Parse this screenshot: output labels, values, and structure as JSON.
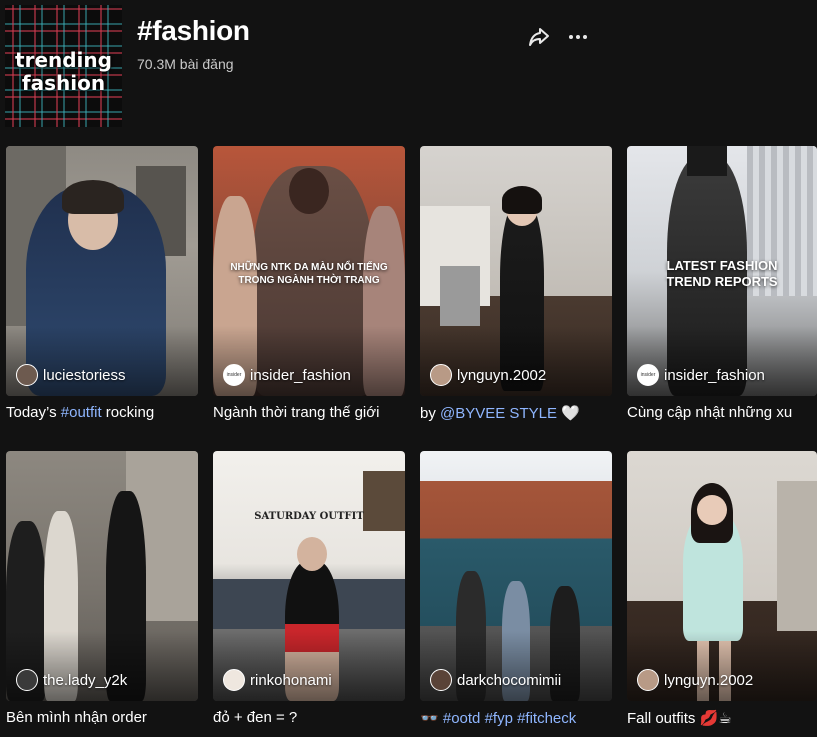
{
  "header": {
    "thumbnail_text_line1": "trending",
    "thumbnail_text_line2": "fashion",
    "title": "#fashion",
    "post_count": "70.3M bài đăng",
    "share_icon": "share-icon",
    "more_icon": "more-icon"
  },
  "posts": [
    {
      "username": "luciestoriess",
      "caption_pre": "Today’s ",
      "caption_hl": "#outfit",
      "caption_post": " rocking",
      "overlay": ""
    },
    {
      "username": "insider_fashion",
      "caption_pre": "Ngành thời trang thế giới",
      "caption_hl": "",
      "caption_post": "",
      "overlay": "NHỮNG NTK DA MÀU NỔI TIẾNG TRONG NGÀNH THỜI TRANG"
    },
    {
      "username": "lyngu yn.2002",
      "caption_pre": "by ",
      "caption_hl": "@BYVEE STYLE",
      "caption_post": " 🤍",
      "overlay": ""
    },
    {
      "username": "insider_fashion",
      "caption_pre": "Cùng cập nhật những xu",
      "caption_hl": "",
      "caption_post": "",
      "overlay": "LATEST FASHION TREND REPORTS"
    },
    {
      "username": "the.lady_y2k",
      "caption_pre": "Bên mình nhận order",
      "caption_hl": "",
      "caption_post": "",
      "overlay": ""
    },
    {
      "username": "rinkohonami",
      "caption_pre": "đỏ + đen = ?",
      "caption_hl": "",
      "caption_post": "",
      "overlay": "SATURDAY OUTFIT"
    },
    {
      "username": "darkchocomimii",
      "caption_pre": "👓 ",
      "caption_hl": "#ootd #fyp #fitcheck",
      "caption_post": "",
      "overlay": ""
    },
    {
      "username": "lyngu yn.2002",
      "caption_pre": "Fall outfits 💋☕",
      "caption_hl": "",
      "caption_post": "",
      "overlay": ""
    }
  ],
  "colors": {
    "background": "#121212",
    "hashtag_link": "#8fb6ff"
  }
}
